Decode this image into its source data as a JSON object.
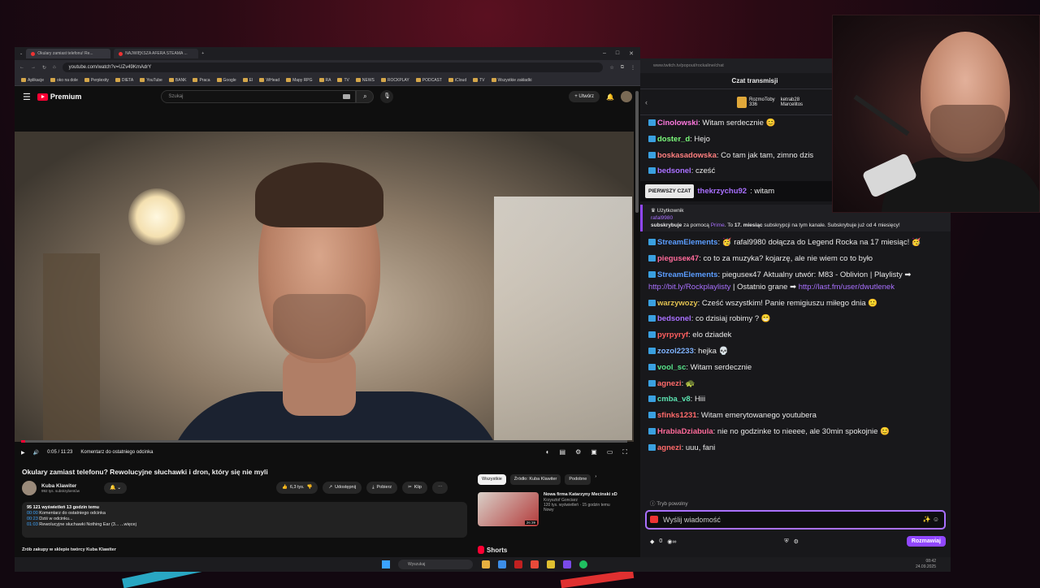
{
  "browser": {
    "tabs": [
      "Okulary zamiast telefonu! Re...",
      "NAJWIĘKSZA AFERA STEAMA ..."
    ],
    "url": "youtube.com/watch?v=UZv49KmAdrY",
    "bookmarks": [
      "Aplikacje",
      "oko na dole",
      "Perplexity",
      "DIETA",
      "YouTube",
      "BANK",
      "Praca",
      "Google",
      "EI",
      "WHead",
      "Mapy RPG",
      "RA",
      "TV",
      "NEWS",
      "ROCKPLAY",
      "PODCAST",
      "iCloud",
      "TV",
      "Wszystkie zakładki"
    ]
  },
  "youtube": {
    "logo": "Premium",
    "search_placeholder": "Szukaj",
    "create_label": "+ Utwórz",
    "player": {
      "time": "0:05 / 11:23",
      "chapter": "Komentarz do ostatniego odcinka",
      "progress": 0.007
    },
    "title": "Okulary zamiast telefonu? Rewolucyjne słuchawki i dron, który się nie myli",
    "channel_name": "Kuba Klawiter",
    "channel_subs": "992 tys. subskrybentów",
    "likes": "6,3 tys.",
    "share": "Udostępnij",
    "download": "Pobierz",
    "clip": "Klip",
    "description": {
      "stats": "95 121 wyświetleń  13 godzin temu",
      "lines": [
        {
          "ts": "00:00",
          "text": "Komentarz do ostatniego odcinka"
        },
        {
          "ts": "00:23",
          "text": "Dziś w odcinku..."
        },
        {
          "ts": "01:03",
          "text": "Rewolucyjne słuchawki Nothing Ear (3... ...więcej"
        }
      ]
    },
    "shop": "Zrób zakupy w sklepie twórcy Kuba Klawiter",
    "chips": [
      "Wszystkie",
      "Źródło: Kuba Klawiter",
      "Podobne"
    ],
    "rec": {
      "title": "Nowa firma Katarzyny Mecinski xD",
      "author": "Krzysztof Gonciarz",
      "meta": "120 tys. wyświetleń · 15 godzin temu",
      "badge": "Nowy",
      "duration": "26:39"
    },
    "shorts": "Shorts"
  },
  "chat": {
    "url": "www.twitch.tv/popout/rockaline/chat",
    "header": "Czat transmisji",
    "top_user": "RozmoToby",
    "top_count": "336",
    "top_user2": "ketrab28",
    "top_user3": "Marcelitos",
    "messages": [
      {
        "user": "Cinolowski",
        "color": "#ff7ae0",
        "text": ": Witam serdecznie 😊"
      },
      {
        "user": "doster_d",
        "color": "#7cfc7c",
        "text": ": Hejo"
      },
      {
        "user": "boskasadowska",
        "color": "#ff7f7f",
        "text": ": Co tam jak tam, zimno dzis"
      },
      {
        "user": "bedsonel",
        "color": "#a970ff",
        "text": ": cześć"
      }
    ],
    "first_tag": "PIERWSZY CZAT",
    "first_user": "thekrzychu92",
    "first_text": ": witam",
    "sub": {
      "label": "Użytkownik",
      "user": "rafal9980",
      "text1": "subskrybuje",
      "text2": " za pomocą ",
      "prime": "Prime",
      "text3": ". To ",
      "months": "17. miesiąc",
      "text4": " subskrypcji na tym kanale. Subskrybuje już od 4 miesięcy!"
    },
    "messages2": [
      {
        "user": "StreamElements",
        "color": "#5b9dff",
        "text": ": 🥳 rafal9980 dołącza do Legend Rocka na 17 miesiąc! 🥳"
      },
      {
        "user": "pieguseк47",
        "color": "#ff6a9a",
        "text": ": co to za muzyka? kojarzę, ale nie wiem co to było"
      },
      {
        "user": "StreamElements",
        "color": "#5b9dff",
        "text": ": pieguseк47 Aktualny utwór: M83 - Oblivion | Playlisty ➡ ",
        "link": "http://bit.ly/Rockplaylisty",
        "text2": " | Ostatnio grane ➡ ",
        "link2": "http://last.fm/user/dwutlenek"
      },
      {
        "user": "warzywozy",
        "color": "#e0c050",
        "text": ": Cześć wszystkim! Panie remigiuszu miłego dnia 🙂"
      },
      {
        "user": "bedsonel",
        "color": "#a970ff",
        "text": ": co dzisiaj robimy ? 😁"
      },
      {
        "user": "pyrpyryf",
        "color": "#ff5f5f",
        "text": ": elo dziadek"
      },
      {
        "user": "zozol2233",
        "color": "#7fb3ff",
        "text": ": hejka 💀"
      },
      {
        "user": "vool_sc",
        "color": "#57e389",
        "text": ": Witam serdecznie"
      },
      {
        "user": "agnezi",
        "color": "#ff6a6a",
        "text": ": 🐢"
      },
      {
        "user": "cmba_v8",
        "color": "#5be3b0",
        "text": ": Hiii"
      },
      {
        "user": "sfinks1231",
        "color": "#ff6a6a",
        "text": ": Witam emerytowanego youtubera"
      },
      {
        "user": "HrabiaDziabula",
        "color": "#ff6a9a",
        "text": ": nie no godzinke to nieeee, ale 30min spokojnie 😊"
      },
      {
        "user": "agnezi",
        "color": "#ff6a6a",
        "text": ": uuu, fani"
      }
    ],
    "slow_mode": "Tryb powolny",
    "input_placeholder": "Wyślij wiadomość",
    "points": "0",
    "send": "Rozmawiaj"
  },
  "taskbar": {
    "search": "Wyszukaj",
    "time": "08:42",
    "date": "24.09.2025"
  }
}
